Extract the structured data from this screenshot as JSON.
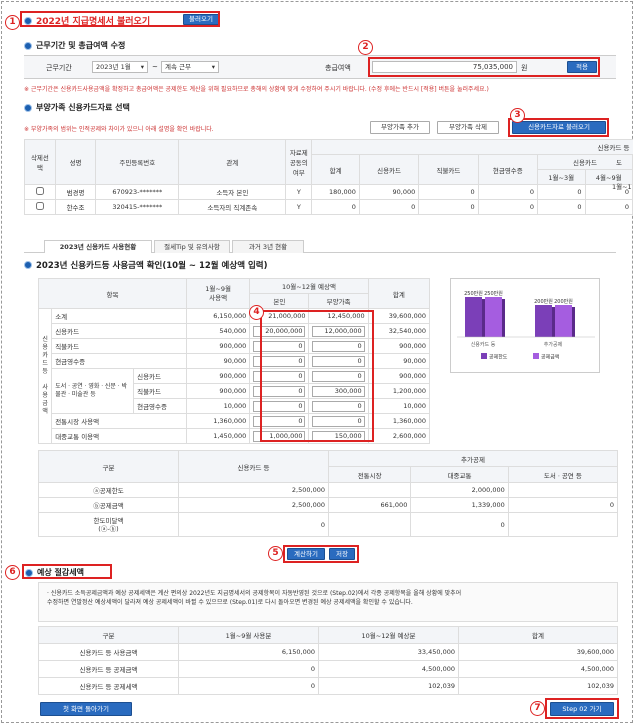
{
  "markers": [
    "1",
    "2",
    "3",
    "4",
    "5",
    "6",
    "7"
  ],
  "section1": {
    "title": "2022년 지급명세서 불러오기",
    "button": "불러오기"
  },
  "section2": {
    "title": "근무기간 및 총급여액 수정",
    "period_label": "근무기간",
    "start": "2023년 1월",
    "tilde": "~",
    "end": "계속 근무",
    "income_label": "총급여액",
    "income_value": "75,035,000",
    "unit": "원",
    "apply": "적용",
    "note": "※ 근무기간은 신용카드사용금액을 확정하고 총급여액은 공제한도 계산을 위해 필요하므로 총해의 상황에 맞게 수정하여 주시기 바랍니다. (수정 후에는 반드시 [적용] 버튼을 눌러주세요.)"
  },
  "section3": {
    "title": "부양가족 신용카드자료 선택",
    "note": "※ 부양가족의 범위는 인적공제와 차이가 있으니 아래 설명을 확인 바랍니다.",
    "add": "부양가족 추가",
    "delete": "부양가족 삭제",
    "load": "신용카드자료 불러오기",
    "headers": {
      "group": "신용카드 등",
      "select": "삭제선택",
      "name": "성명",
      "rrn": "주민등록번호",
      "relation": "관계",
      "consent": "자료제공동의여부",
      "total": "합계",
      "credit": "신용카드",
      "debit": "직불카드",
      "cash": "현금영수증",
      "credit2": "신용카드",
      "d": "도",
      "m13": "1월~3월",
      "m49": "4월~9월",
      "m1": "1월~1"
    },
    "rows": [
      {
        "name": "범경명",
        "rrn": "670923-*******",
        "relation": "소득자 본인",
        "consent": "Y",
        "total": "180,000",
        "credit": "90,000",
        "debit": "0",
        "cash": "0",
        "m13": "0",
        "m49": "0"
      },
      {
        "name": "한수조",
        "rrn": "320415-*******",
        "relation": "소득자의 직계존속",
        "consent": "Y",
        "total": "0",
        "credit": "0",
        "debit": "0",
        "cash": "0",
        "m13": "0",
        "m49": "0"
      }
    ]
  },
  "tabs": [
    "2023년 신용카드 사용현황",
    "절세Tip 및 유의사항",
    "과거 3년 현황"
  ],
  "section4": {
    "title": "2023년 신용카드등 사용금액 확인(10월 ~ 12월 예상액 입력)",
    "headers": {
      "item": "항목",
      "used": "1월~9월\n사용액",
      "forecast": "10월~12월 예상액",
      "self": "본인",
      "dep": "부양가족",
      "total": "합계",
      "side1": "신용카드등",
      "side2": "사용금액",
      "culture": "도서ㆍ공연ㆍ영화ㆍ신문ㆍ박물관ㆍ미술관 등"
    },
    "rows": [
      {
        "label": "소계",
        "used": "6,150,000",
        "self": "21,000,000",
        "dep": "12,450,000",
        "total": "39,600,000"
      },
      {
        "label": "신용카드",
        "used": "540,000",
        "self": "20,000,000",
        "dep": "12,000,000",
        "total": "32,540,000"
      },
      {
        "label": "직불카드",
        "used": "900,000",
        "self": "0",
        "dep": "0",
        "total": "900,000"
      },
      {
        "label": "현금영수증",
        "used": "90,000",
        "self": "0",
        "dep": "0",
        "total": "90,000"
      },
      {
        "label": "신용카드",
        "used": "900,000",
        "self": "0",
        "dep": "0",
        "total": "900,000"
      },
      {
        "label": "직불카드",
        "used": "900,000",
        "self": "0",
        "dep": "300,000",
        "total": "1,200,000"
      },
      {
        "label": "현금영수증",
        "used": "10,000",
        "self": "0",
        "dep": "0",
        "total": "10,000"
      },
      {
        "label": "전통시장 사용액",
        "used": "1,360,000",
        "self": "0",
        "dep": "0",
        "total": "1,360,000"
      },
      {
        "label": "대중교통 이용액",
        "used": "1,450,000",
        "self": "1,000,000",
        "dep": "150,000",
        "total": "2,600,000"
      }
    ]
  },
  "chart_data": {
    "type": "bar",
    "categories": [
      "신용카드 등",
      "추가공제"
    ],
    "series": [
      {
        "name": "공제한도",
        "values": [
          250,
          200
        ]
      },
      {
        "name": "공제금액",
        "values": [
          250,
          200
        ]
      }
    ],
    "data_labels": [
      "250만원",
      "250만원",
      "200만원",
      "200만원"
    ],
    "legend": [
      "공제한도",
      "공제금액"
    ],
    "colors": [
      "#7b3fb8",
      "#a55de0"
    ]
  },
  "deduction": {
    "header_gubun": "구분",
    "header_card": "신용카드 등",
    "header_extra": "추가공제",
    "header_market": "전통시장",
    "header_transit": "대중교통",
    "header_culture": "도서ㆍ공연 등",
    "rows": [
      {
        "label": "ⓐ공제한도",
        "card": "2,500,000",
        "market": "",
        "transit": "2,000,000",
        "culture": ""
      },
      {
        "label": "ⓑ공제금액",
        "card": "2,500,000",
        "market": "661,000",
        "transit": "1,339,000",
        "culture": "0"
      },
      {
        "label": "한도미달액\n(ⓐ-ⓑ)",
        "card": "0",
        "market": "",
        "transit": "0",
        "culture": ""
      }
    ]
  },
  "buttons": {
    "calc": "계산하기",
    "save": "저장",
    "back": "첫 화면 돌아가기",
    "next": "Step 02 가기"
  },
  "section5": {
    "title": "예상 절감세액",
    "note": "· 신용카드 소득공제금액과 예상 공제세액은 계산 편의상 2022년도 지급명세서의 공제항목이 자동반영된 것으로 (Step.02)에서 각종 공제항목을 올해 상황에 맞추어\n  수정하면 연말정산 예상세액이 달라져 예상 공제세액이 바뀔 수 있으므로 (Step.01)로 다시 돌아오면 변경된 예상 공제세액을 확인할 수 있습니다.",
    "headers": [
      "구분",
      "1월~9월 사용분",
      "10월~12월 예상분",
      "합계"
    ],
    "rows": [
      [
        "신용카드 등 사용금액",
        "6,150,000",
        "33,450,000",
        "39,600,000"
      ],
      [
        "신용카드 등 공제금액",
        "0",
        "4,500,000",
        "4,500,000"
      ],
      [
        "신용카드 등 공제세액",
        "0",
        "102,039",
        "102,039"
      ]
    ]
  }
}
